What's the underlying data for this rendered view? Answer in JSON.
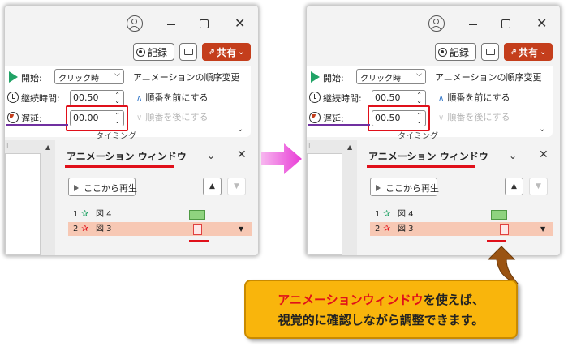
{
  "window_controls": {
    "minimize": "minimize",
    "maximize": "maximize",
    "close": "✕"
  },
  "commands": {
    "record_label": "記録",
    "share_label": "共有",
    "share_dropdown": "⌄"
  },
  "ribbon": {
    "start_label": "開始:",
    "start_value": "クリック時",
    "duration_label": "継続時間:",
    "duration_value": "00.50",
    "delay_label": "遅延:",
    "group_label": "タイミング",
    "reorder_title": "アニメーションの順序変更",
    "move_earlier": "順番を前にする",
    "move_later": "順番を後にする"
  },
  "before": {
    "delay_value": "00.00"
  },
  "after": {
    "delay_value": "00.50"
  },
  "animation_pane": {
    "title": "アニメーション ウィンドウ",
    "play_from_label": "ここから再生",
    "items": [
      {
        "number": "1",
        "object": "図 4",
        "selected": false
      },
      {
        "number": "2",
        "object": "図 3",
        "selected": true
      }
    ]
  },
  "callout": {
    "line1_highlight": "アニメーションウィンドウ",
    "line1_rest": "を使えば、",
    "line2": "視覚的に確認しながら調整できます。"
  },
  "colors": {
    "accent_red": "#e0101a",
    "share_button": "#c43e1c",
    "callout_fill": "#f9b50c",
    "arrow_magenta": "#e83bd6",
    "pointer_brown": "#9a5312",
    "selected_row": "#f7c8b4",
    "purple_underline": "#7030a0"
  }
}
